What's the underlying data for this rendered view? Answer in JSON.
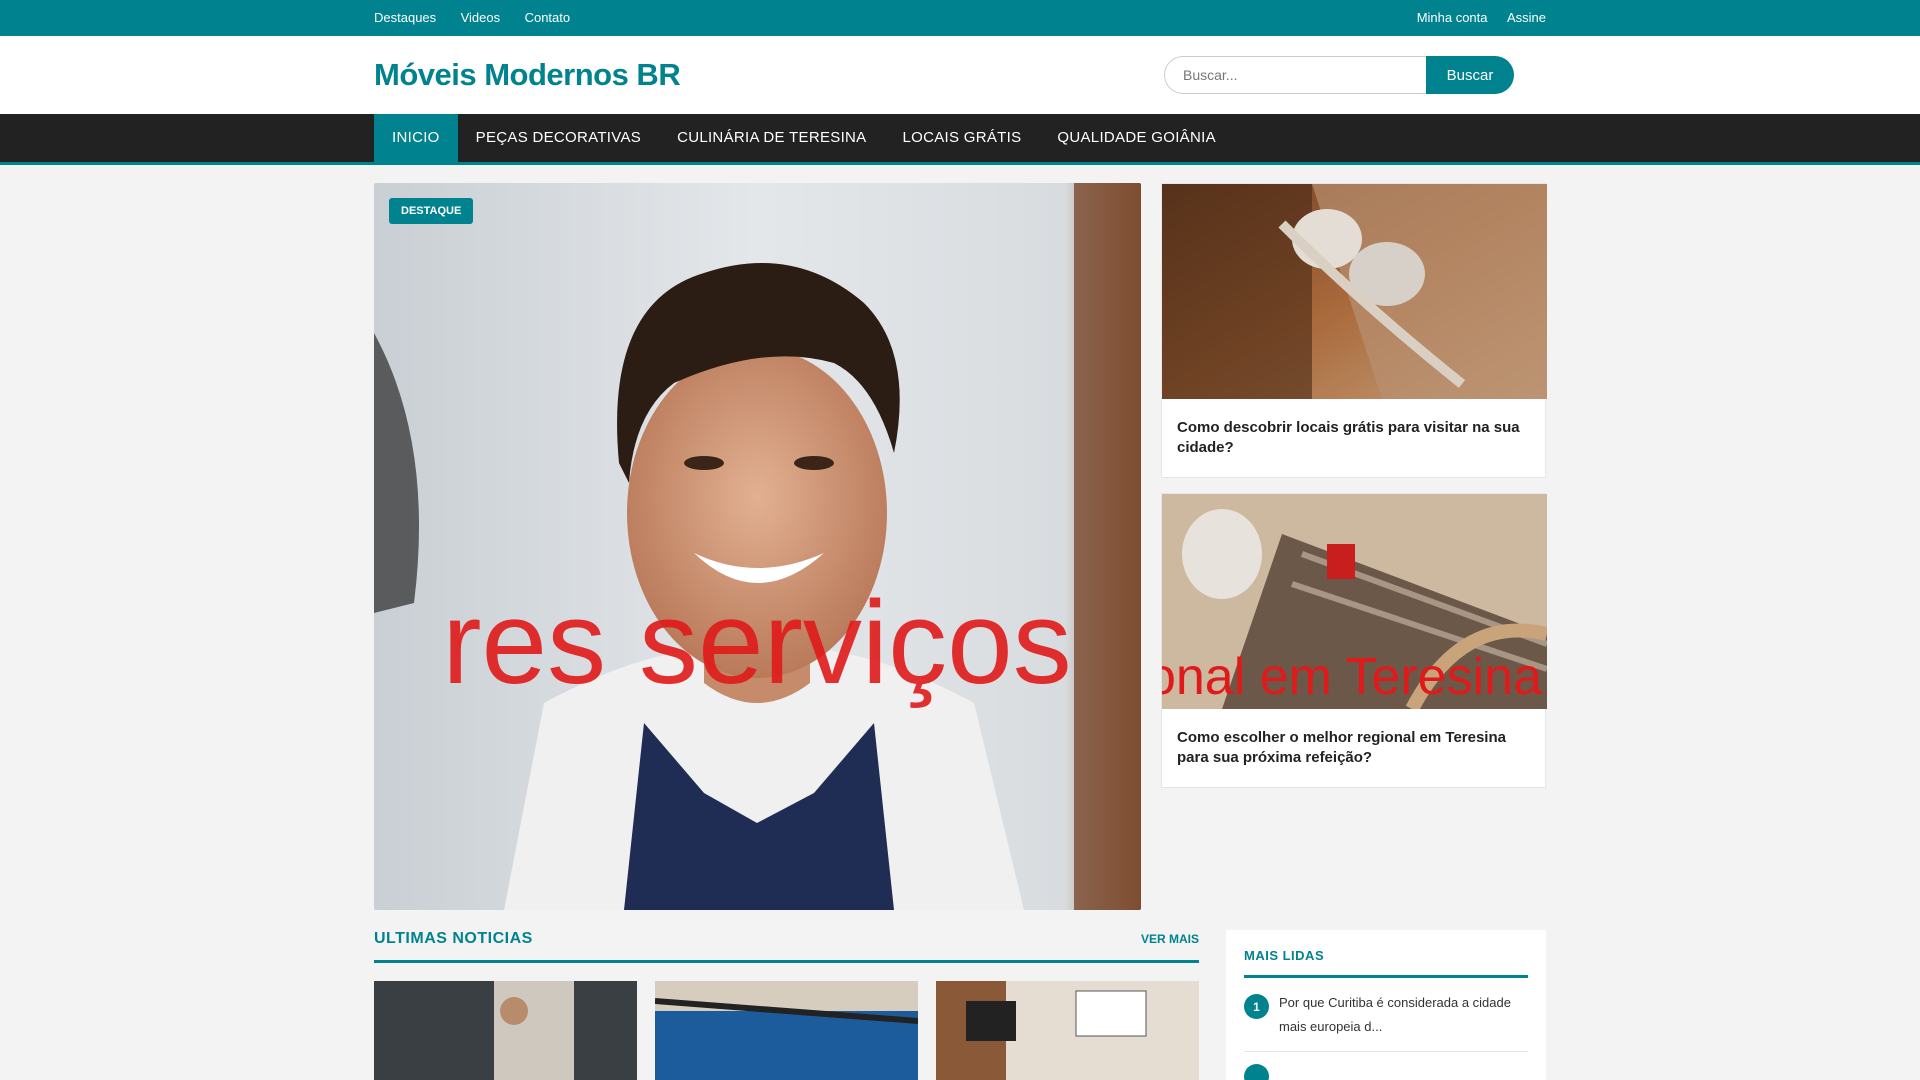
{
  "topbar": {
    "links": [
      "Destaques",
      "Videos",
      "Contato"
    ],
    "account": "Minha conta",
    "subscribe": "Assine"
  },
  "header": {
    "logo": "Móveis Modernos BR",
    "search_placeholder": "Buscar...",
    "search_button": "Buscar"
  },
  "nav": {
    "items": [
      "INICIO",
      "PEÇAS DECORATIVAS",
      "CULINÁRIA DE TERESINA",
      "LOCAIS GRÁTIS",
      "QUALIDADE GOIÂNIA"
    ]
  },
  "hero": {
    "badge": "DESTAQUE",
    "overlay_text": "res serviços"
  },
  "side_cards": [
    {
      "title": "Como descobrir locais grátis para visitar na sua cidade?"
    },
    {
      "title": "Como escolher o melhor regional em Teresina para sua próxima refeição?",
      "overlay_text": "ional em Teresina"
    }
  ],
  "news": {
    "title": "ULTIMAS NOTICIAS",
    "more": "VER MAIS"
  },
  "sidebar": {
    "title": "MAIS LIDAS",
    "items": [
      {
        "num": "1",
        "text": "Por que Curitiba é considerada a cidade mais europeia d..."
      }
    ]
  },
  "colors": {
    "accent": "#00838f",
    "nav_bg": "#222222"
  }
}
